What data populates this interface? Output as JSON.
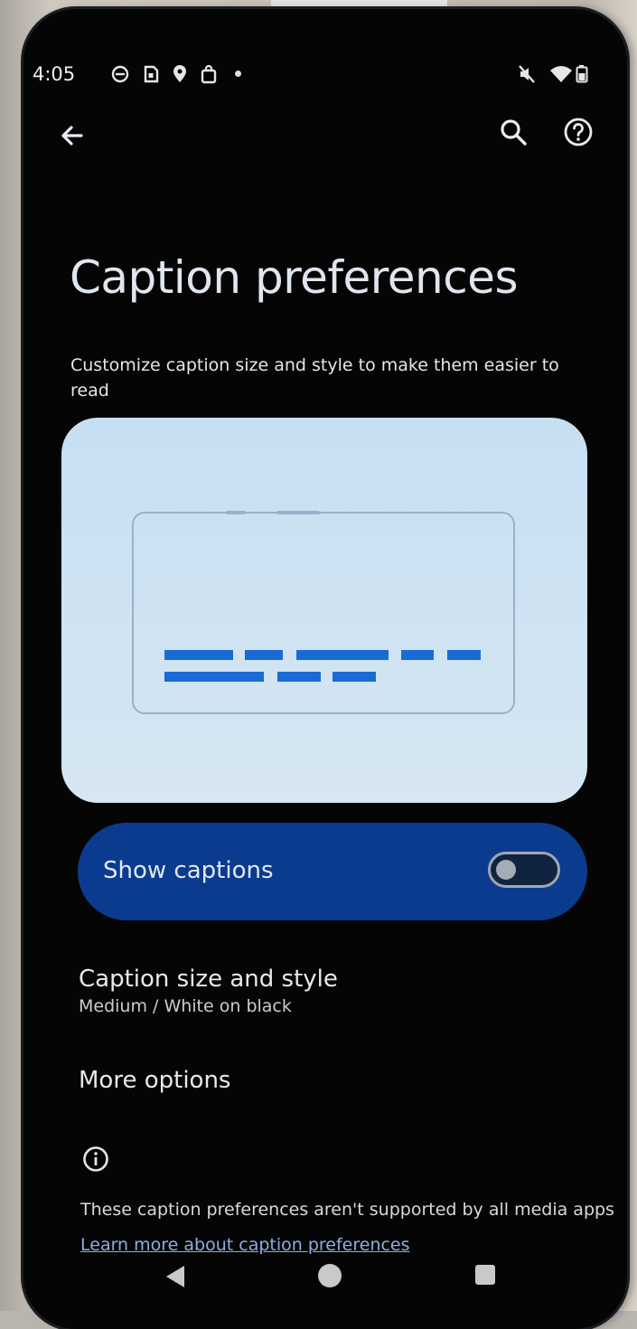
{
  "status_bar": {
    "time": "4:05",
    "left_icons": [
      "messenger-icon",
      "sim-icon",
      "location-pin-icon",
      "shopping-bag-icon"
    ],
    "right_icons": [
      "ringer-mute-icon",
      "wifi-icon",
      "battery-icon"
    ]
  },
  "app_bar": {
    "back_icon": "arrow-back-icon",
    "search_icon": "search-icon",
    "help_icon": "help-icon"
  },
  "page": {
    "title": "Caption preferences",
    "description": "Customize caption size and style to make them easier to read"
  },
  "preview": {
    "colors": {
      "background": "#c7dff2",
      "frame": "#97b2ca",
      "caption_bars": "#1a6ad6"
    }
  },
  "show_captions": {
    "label": "Show captions",
    "checked": false,
    "color": "#0b3b8f"
  },
  "caption_size_style": {
    "title": "Caption size and style",
    "summary": "Medium / White on black"
  },
  "more_options": {
    "title": "More options"
  },
  "footer": {
    "info_icon": "info-icon",
    "text": "These caption preferences aren't supported by all media apps",
    "link": "Learn more about caption preferences"
  },
  "nav_bar": {
    "items": [
      "nav-back-icon",
      "nav-home-icon",
      "nav-recents-icon"
    ]
  }
}
